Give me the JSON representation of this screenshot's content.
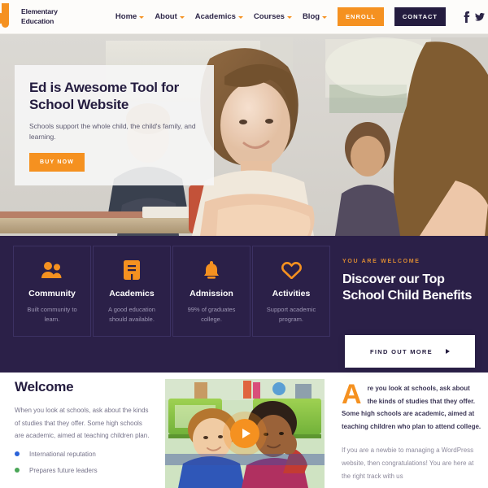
{
  "header": {
    "logo": {
      "line1": "Elementary",
      "line2": "Education",
      "icon": "graduation-j-logo"
    },
    "nav": [
      {
        "label": "Home",
        "has_caret": true
      },
      {
        "label": "About",
        "has_caret": true
      },
      {
        "label": "Academics",
        "has_caret": true
      },
      {
        "label": "Courses",
        "has_caret": true
      },
      {
        "label": "Blog",
        "has_caret": true
      }
    ],
    "enroll_label": "ENROLL",
    "contact_label": "CONTACT",
    "social": [
      {
        "name": "facebook-icon"
      },
      {
        "name": "twitter-icon"
      }
    ]
  },
  "hero": {
    "title": "Ed is Awesome Tool for School Website",
    "subtitle": "Schools support the whole child, the child's family, and learning.",
    "button_label": "BUY NOW",
    "image_alt": "classroom-students-photo"
  },
  "features": {
    "cards": [
      {
        "icon": "people-icon",
        "title": "Community",
        "desc": "Built community to learn."
      },
      {
        "icon": "book-icon",
        "title": "Academics",
        "desc": "A good education should available."
      },
      {
        "icon": "bell-icon",
        "title": "Admission",
        "desc": "99% of graduates college."
      },
      {
        "icon": "heart-icon",
        "title": "Activities",
        "desc": "Support academic program."
      }
    ]
  },
  "benefits": {
    "eyebrow": "YOU ARE WELCOME",
    "title": "Discover our Top School Child Benefits",
    "cta_label": "FIND OUT MORE"
  },
  "welcome": {
    "heading": "Welcome",
    "paragraph": "When you look at schools, ask about the kinds of studies that they offer. Some high schools are academic, aimed at teaching children plan.",
    "bullets": [
      {
        "text": "International reputation",
        "color": "#2b63d9"
      },
      {
        "text": "Prepares future leaders",
        "color": "#4aa657"
      }
    ]
  },
  "video": {
    "alt": "two-children-in-classroom-photo",
    "play_icon": "play-icon"
  },
  "right_column": {
    "dropcap": "A",
    "lead": "re you look at schools, ask about the kinds of studies that they offer. Some high schools are academic, aimed at teaching children who plan to attend college.",
    "body": "If you are a newbie to managing a WordPress website, then congratulations! You are here at the right track with  us"
  },
  "colors": {
    "accent_orange": "#f59120",
    "dark_purple": "#2b2048",
    "navy_text": "#241c3f",
    "muted_text": "#76738a"
  }
}
